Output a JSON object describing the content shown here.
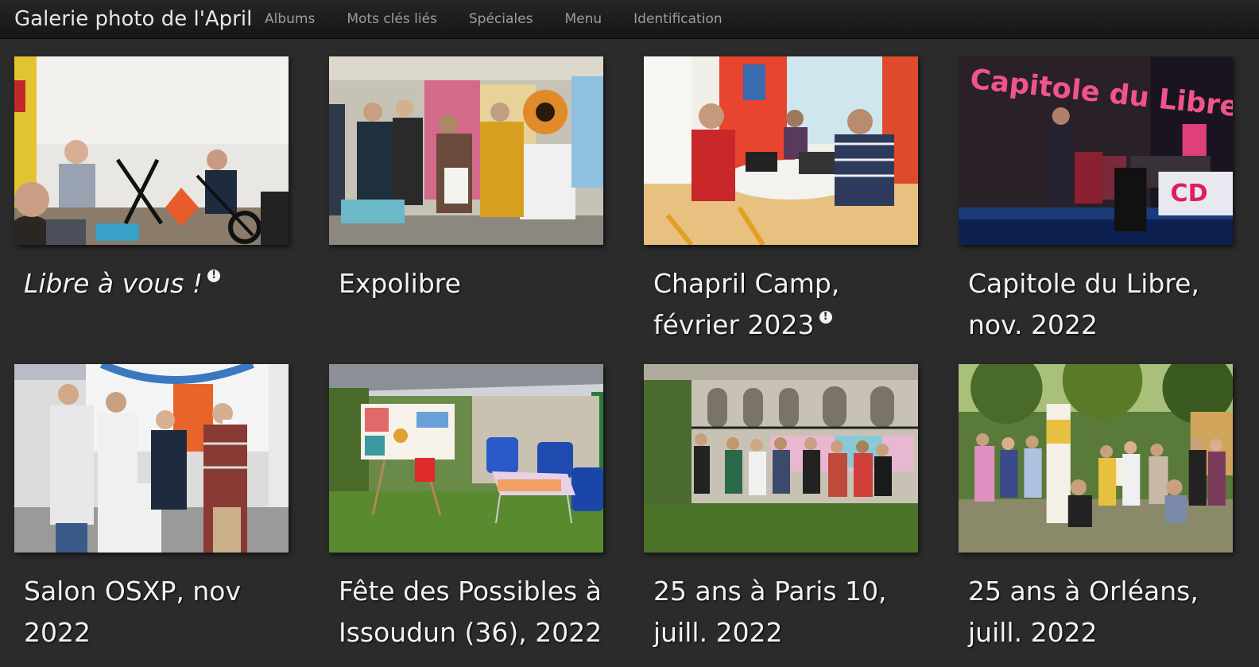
{
  "header": {
    "brand": "Galerie photo de l'April",
    "nav": [
      "Albums",
      "Mots clés liés",
      "Spéciales",
      "Menu",
      "Identification"
    ]
  },
  "albums": [
    {
      "title": "Libre à vous !",
      "italic": true,
      "notice": true
    },
    {
      "title": "Expolibre",
      "italic": false,
      "notice": false
    },
    {
      "title": "Chapril Camp, février 2023",
      "italic": false,
      "notice": true
    },
    {
      "title": "Capitole du Libre, nov. 2022",
      "italic": false,
      "notice": false
    },
    {
      "title": "Salon OSXP, nov 2022",
      "italic": false,
      "notice": false
    },
    {
      "title": "Fête des Possibles à Issoudun (36), 2022",
      "italic": false,
      "notice": false
    },
    {
      "title": "25 ans à Paris 10, juill. 2022",
      "italic": false,
      "notice": false
    },
    {
      "title": "25 ans à Orléans, juill. 2022",
      "italic": false,
      "notice": false
    }
  ],
  "photo_text": {
    "capitole_sign": "Capitole du Libre"
  },
  "icons": {
    "notice": "exclamation-circle-icon"
  }
}
